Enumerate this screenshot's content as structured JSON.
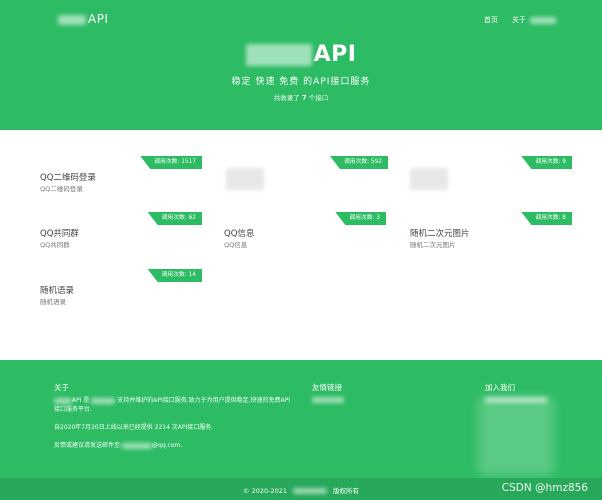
{
  "header": {
    "logo_text": "API",
    "nav": [
      "首页",
      "关于"
    ]
  },
  "hero": {
    "title": "API",
    "subtitle": "稳定 快速 免费 的API接口服务",
    "count_prefix": "共收录了",
    "count_value": "7",
    "count_suffix": "个接口"
  },
  "apis": [
    {
      "title": "QQ二维码登录",
      "desc": "QQ二维码登录",
      "badge": "调用次数: 1517"
    },
    {
      "title": "",
      "desc": "",
      "badge": "调用次数: 592"
    },
    {
      "title": "",
      "desc": "",
      "badge": "调用次数: 9"
    },
    {
      "title": "QQ共同群",
      "desc": "QQ共同群",
      "badge": "调用次数: 62"
    },
    {
      "title": "QQ信息",
      "desc": "QQ信息",
      "badge": "调用次数: 3"
    },
    {
      "title": "随机二次元图片",
      "desc": "随机二次元图片",
      "badge": "调用次数: 8"
    },
    {
      "title": "随机语录",
      "desc": "随机语录",
      "badge": "调用次数: 14"
    }
  ],
  "footer": {
    "about_title": "关于",
    "about_line1": "API 是",
    "about_line1b": "支持并维护的API接口服务,致力于为用户提供稳定,快速的免费API",
    "about_line2": "接口服务平台.",
    "about_since": "自2020年7月20日上线以来已经提供 2214 次API接口服务.",
    "feedback_prefix": "反馈或建议请发送邮件至:",
    "feedback_domain": "@qq.com.",
    "links_title": "友情链接",
    "join_title": "加入我们"
  },
  "bottom": {
    "copyright_prefix": "© 2020-2021",
    "copyright_suffix": "版权所有",
    "watermark": "CSDN @hmz856"
  },
  "colors": {
    "brand_green": "#2dbb64",
    "bottom_green": "#27a85a"
  }
}
